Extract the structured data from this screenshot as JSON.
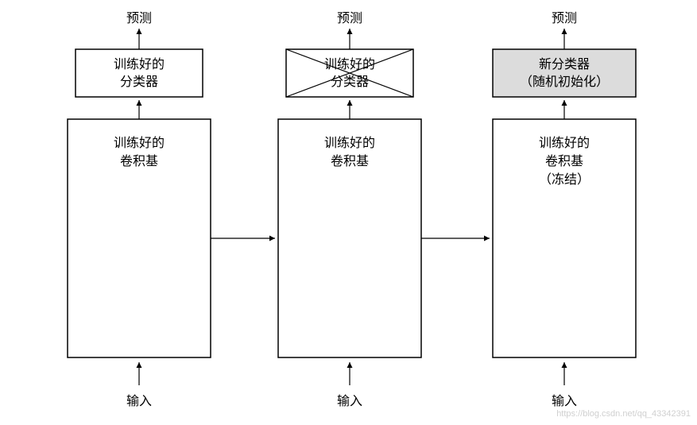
{
  "columns": [
    {
      "top_label": "预测",
      "classifier_line1": "训练好的",
      "classifier_line2": "分类器",
      "classifier_crossed": false,
      "classifier_fill": "#ffffff",
      "base_line1": "训练好的",
      "base_line2": "卷积基",
      "base_line3": "",
      "bottom_label": "输入"
    },
    {
      "top_label": "预测",
      "classifier_line1": "训练好的",
      "classifier_line2": "分类器",
      "classifier_crossed": true,
      "classifier_fill": "#ffffff",
      "base_line1": "训练好的",
      "base_line2": "卷积基",
      "base_line3": "",
      "bottom_label": "输入"
    },
    {
      "top_label": "预测",
      "classifier_line1": "新分类器",
      "classifier_line2": "（随机初始化）",
      "classifier_crossed": false,
      "classifier_fill": "#dcdcdc",
      "base_line1": "训练好的",
      "base_line2": "卷积基",
      "base_line3": "（冻结）",
      "bottom_label": "输入"
    }
  ],
  "watermark": "https://blog.csdn.net/qq_43342391",
  "chart_data": {
    "type": "diagram",
    "title": "",
    "description": "Transfer learning / feature extraction diagram with three columns showing: original trained model, removing classifier, adding new classifier on frozen convolutional base",
    "flow": [
      {
        "column": 1,
        "stages": [
          "输入",
          "训练好的卷积基",
          "训练好的分类器",
          "预测"
        ]
      },
      {
        "column": 2,
        "stages": [
          "输入",
          "训练好的卷积基",
          "训练好的分类器 (crossed out)",
          "预测"
        ]
      },
      {
        "column": 3,
        "stages": [
          "输入",
          "训练好的卷积基（冻结）",
          "新分类器（随机初始化）",
          "预测"
        ]
      }
    ],
    "horizontal_arrows": [
      "col1→col2",
      "col2→col3"
    ]
  }
}
